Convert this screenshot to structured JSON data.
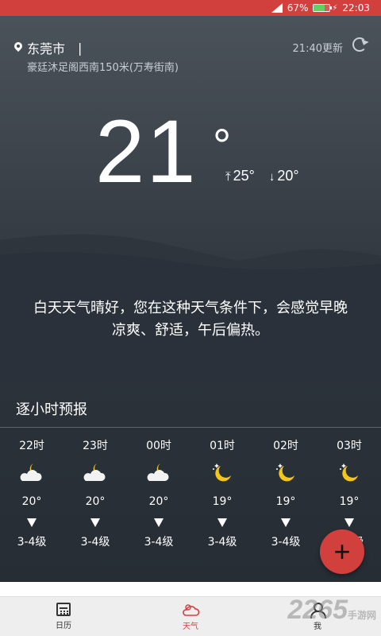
{
  "status_bar": {
    "battery": "67%",
    "battery_level": 0.67,
    "time": "22:03"
  },
  "location": {
    "city": "东莞市",
    "cursor": "|",
    "address": "豪廷沐足阁西南150米(万寿街南)",
    "updated": "21:40更新"
  },
  "current": {
    "temp": "21",
    "degree": "°",
    "high": "25°",
    "low": "20°"
  },
  "description": "白天天气晴好，您在这种天气条件下，会感觉早晚凉爽、舒适，午后偏热。",
  "hourly": {
    "title": "逐小时预报",
    "items": [
      {
        "time": "22时",
        "icon": "cloudy-night-icon",
        "temp": "20°",
        "wind": "3-4级"
      },
      {
        "time": "23时",
        "icon": "cloudy-night-icon",
        "temp": "20°",
        "wind": "3-4级"
      },
      {
        "time": "00时",
        "icon": "cloudy-night-icon",
        "temp": "20°",
        "wind": "3-4级"
      },
      {
        "time": "01时",
        "icon": "clear-night-icon",
        "temp": "19°",
        "wind": "3-4级"
      },
      {
        "time": "02时",
        "icon": "clear-night-icon",
        "temp": "19°",
        "wind": "3-4级"
      },
      {
        "time": "03时",
        "icon": "clear-night-icon",
        "temp": "19°",
        "wind": "3-4级"
      }
    ]
  },
  "fab": {
    "label": "+"
  },
  "tabs": [
    {
      "label": "日历",
      "icon": "calendar-icon"
    },
    {
      "label": "天气",
      "icon": "weather-icon"
    },
    {
      "label": "我",
      "icon": "user-icon"
    }
  ],
  "colors": {
    "accent": "#d2403e",
    "moon": "#f5c518"
  },
  "watermark": {
    "brand": "2265",
    "sub": "手游网"
  }
}
